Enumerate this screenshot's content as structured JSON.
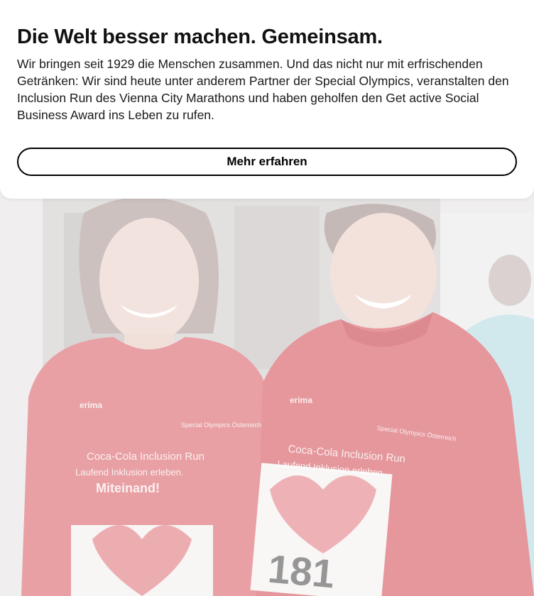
{
  "promo": {
    "title": "Die Welt besser machen. Gemeinsam.",
    "body": "Wir bringen seit 1929 die Menschen zusammen. Und das nicht nur mit erfrischenden Getränken: Wir sind heute unter anderem Partner der Special Olympics, veranstalten den Inclusion Run des Vienna City Marathons und haben geholfen den Get active Social Business Award ins Leben zu rufen.",
    "cta_label": "Mehr erfahren"
  },
  "photo": {
    "shirt_left": {
      "brand": "erima",
      "sponsor_line": "Coca-Cola Inclusion Run",
      "slogan": "Laufend Inklusion erleben.",
      "tagline": "Miteinand!",
      "badge": "Special Olympics Österreich"
    },
    "shirt_right": {
      "brand": "erima",
      "sponsor_line": "Coca-Cola Inclusion Run",
      "slogan": "Laufend Inklusion erleben.",
      "badge": "Special Olympics Österreich"
    },
    "bib_number": "181"
  },
  "colors": {
    "shirt_red": "#d9474f",
    "card_bg": "#ffffff",
    "text": "#111111"
  }
}
